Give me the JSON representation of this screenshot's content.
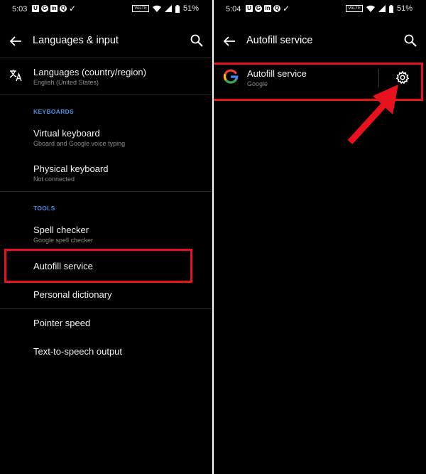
{
  "left": {
    "status": {
      "time": "5:03",
      "notif_icons": [
        "U",
        "G",
        "in",
        "Q",
        "✓"
      ],
      "volte": "VoLTE",
      "battery": "51%"
    },
    "title": "Languages & input",
    "languages": {
      "label": "Languages (country/region)",
      "sub": "English (United States)"
    },
    "keyboards_header": "KEYBOARDS",
    "virtual_keyboard": {
      "label": "Virtual keyboard",
      "sub": "Gboard and Google voice typing"
    },
    "physical_keyboard": {
      "label": "Physical keyboard",
      "sub": "Not connected"
    },
    "tools_header": "TOOLS",
    "spell_checker": {
      "label": "Spell checker",
      "sub": "Google spell checker"
    },
    "autofill": {
      "label": "Autofill service"
    },
    "personal_dictionary": {
      "label": "Personal dictionary"
    },
    "pointer_speed": {
      "label": "Pointer speed"
    },
    "tts": {
      "label": "Text-to-speech output"
    }
  },
  "right": {
    "status": {
      "time": "5:04",
      "notif_icons": [
        "U",
        "G",
        "in",
        "Q",
        "✓"
      ],
      "volte": "VoLTE",
      "battery": "51%"
    },
    "title": "Autofill service",
    "service": {
      "label": "Autofill service",
      "sub": "Google"
    }
  },
  "colors": {
    "background": "#000000",
    "accent": "#4a90e2",
    "highlight": "#e8111e"
  },
  "icons": [
    "back-arrow-icon",
    "search-icon",
    "translate-icon",
    "google-logo-icon",
    "gear-icon",
    "annotation-arrow"
  ]
}
